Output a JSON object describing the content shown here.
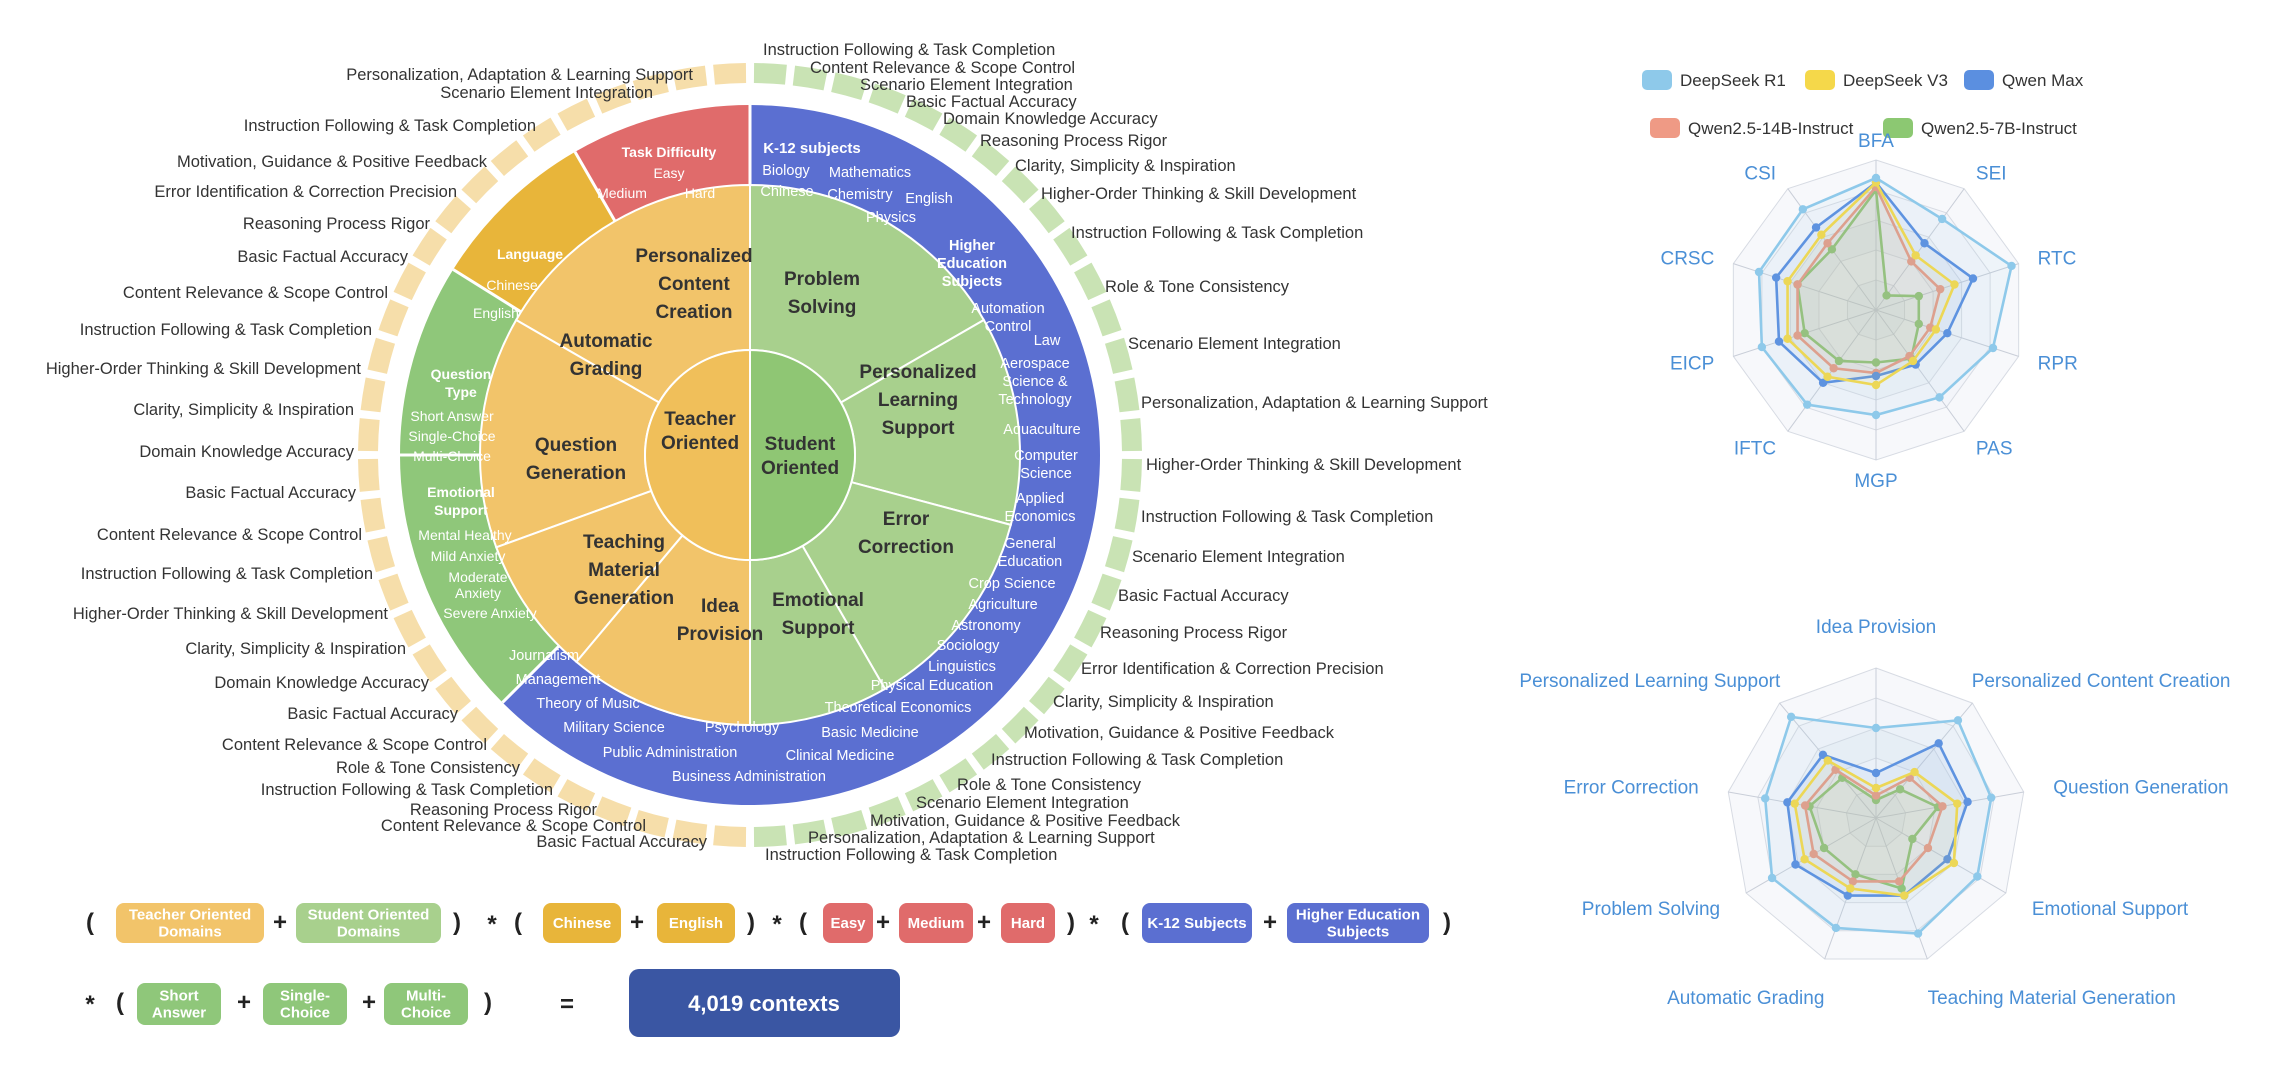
{
  "left_ring_labels": [
    "Personalization, Adaptation & Learning Support",
    "Scenario Element Integration",
    "Instruction Following & Task Completion",
    "Motivation, Guidance & Positive Feedback",
    "Error Identification & Correction Precision",
    "Reasoning Process Rigor",
    "Basic Factual Accuracy",
    "Content Relevance & Scope Control",
    "Instruction Following & Task Completion",
    "Higher-Order Thinking & Skill Development",
    "Clarity, Simplicity & Inspiration",
    "Domain Knowledge Accuracy",
    "Basic Factual Accuracy",
    "Content Relevance & Scope Control",
    "Instruction Following & Task Completion",
    "Higher-Order Thinking & Skill Development",
    "Clarity, Simplicity & Inspiration",
    "Domain Knowledge Accuracy",
    "Basic Factual Accuracy",
    "Content Relevance & Scope Control",
    "Role & Tone Consistency",
    "Instruction Following & Task Completion",
    "Reasoning Process Rigor",
    "Content Relevance & Scope Control",
    "Basic Factual Accuracy"
  ],
  "right_ring_labels": [
    "Instruction Following & Task Completion",
    "Content Relevance & Scope Control",
    "Scenario Element Integration",
    "Basic Factual Accuracy",
    "Domain Knowledge Accuracy",
    "Reasoning Process Rigor",
    "Clarity, Simplicity & Inspiration",
    "Higher-Order Thinking & Skill Development",
    "Instruction Following & Task Completion",
    "Role & Tone Consistency",
    "Scenario Element Integration",
    "Personalization, Adaptation & Learning Support",
    "Higher-Order Thinking & Skill Development",
    "Instruction Following & Task Completion",
    "Scenario Element Integration",
    "Basic Factual Accuracy",
    "Reasoning Process Rigor",
    "Error Identification & Correction Precision",
    "Clarity, Simplicity & Inspiration",
    "Motivation, Guidance & Positive Feedback",
    "Instruction Following & Task Completion",
    "Role & Tone Consistency",
    "Scenario Element Integration",
    "Motivation, Guidance & Positive Feedback",
    "Personalization, Adaptation & Learning Support",
    "Instruction Following & Task Completion"
  ],
  "wheel": {
    "center_left": "Teacher Oriented",
    "center_right": "Student Oriented",
    "teacher_segments": [
      "Personalized Content Creation",
      "Automatic Grading",
      "Question Generation",
      "Teaching Material Generation"
    ],
    "student_segments": [
      "Problem Solving",
      "Personalized Learning Support",
      "Error Correction",
      "Emotional Support",
      "Idea Provision"
    ],
    "difficulty": {
      "title": "Task Difficulty",
      "easy": "Easy",
      "medium": "Medium",
      "hard": "Hard"
    },
    "language": {
      "title": "Language",
      "chinese": "Chinese",
      "english": "English"
    },
    "question_type": {
      "title": "Question Type",
      "items": [
        "Short Answer",
        "Single-Choice",
        "Multi-Choice"
      ]
    },
    "emotional": {
      "title": "Emotional Support",
      "items": [
        "Mental Healthy",
        "Mild Anxiety",
        "Moderate Anxiety",
        "Severe Anxiety"
      ]
    },
    "k12": {
      "title": "K-12 subjects",
      "items": [
        "Biology",
        "Mathematics",
        "Chinese",
        "Chemistry",
        "English",
        "Physics"
      ]
    },
    "higher": {
      "title": "Higher Education Subjects",
      "items": [
        "Automation Control",
        "Law",
        "Aerospace Science & Technology",
        "Aquaculture",
        "Computer Science",
        "Applied Economics",
        "General Education",
        "Crop Science",
        "Agriculture",
        "Astronomy",
        "Sociology",
        "Linguistics",
        "Physical Education",
        "Theoretical Economics",
        "Basic Medicine",
        "Clinical Medicine",
        "Business Administration",
        "Psychology",
        "Public Administration",
        "Military Science",
        "Theory of Music",
        "Management",
        "Journalism"
      ]
    }
  },
  "formula": {
    "teacher": "Teacher Oriented Domains",
    "student": "Student Oriented Domains",
    "chinese": "Chinese",
    "english": "English",
    "easy": "Easy",
    "medium": "Medium",
    "hard": "Hard",
    "k12": "K-12 Subjects",
    "higher": "Higher Education Subjects",
    "short": "Short Answer",
    "single": "Single-Choice",
    "multi": "Multi-Choice",
    "result": "4,019 contexts",
    "plus": "+",
    "times": "*",
    "equals": "=",
    "open": "(",
    "close": ")"
  },
  "colors": {
    "teacher": "#f2c46a",
    "student": "#a8d08d",
    "difficulty": "#e06b6b",
    "language": "#e8b53a",
    "question": "#8fc77a",
    "subjects": "#5b6fd1",
    "result": "#3a56a3"
  },
  "chart_data": [
    {
      "type": "radar",
      "axes": [
        "BFA",
        "SEI",
        "RTC",
        "RPR",
        "PAS",
        "MGP",
        "IFTC",
        "EICP",
        "CRSC",
        "CSI"
      ],
      "legend": [
        "DeepSeek R1",
        "DeepSeek V3",
        "Qwen Max",
        "Qwen2.5-14B-Instruct",
        "Qwen2.5-7B-Instruct"
      ],
      "series": [
        {
          "name": "DeepSeek R1",
          "color": "#8ec9ea",
          "values": [
            0.88,
            0.75,
            0.95,
            0.82,
            0.72,
            0.7,
            0.78,
            0.8,
            0.82,
            0.83
          ]
        },
        {
          "name": "DeepSeek V3",
          "color": "#f5d84a",
          "values": [
            0.85,
            0.45,
            0.55,
            0.42,
            0.42,
            0.5,
            0.55,
            0.62,
            0.62,
            0.62
          ]
        },
        {
          "name": "Qwen Max",
          "color": "#5b8fe0",
          "values": [
            0.85,
            0.55,
            0.68,
            0.5,
            0.45,
            0.44,
            0.6,
            0.68,
            0.7,
            0.68
          ]
        },
        {
          "name": "Qwen2.5-14B-Instruct",
          "color": "#ef9a85",
          "values": [
            0.82,
            0.4,
            0.45,
            0.38,
            0.38,
            0.42,
            0.48,
            0.55,
            0.55,
            0.55
          ]
        },
        {
          "name": "Qwen2.5-7B-Instruct",
          "color": "#8cc872",
          "values": [
            0.8,
            0.12,
            0.3,
            0.3,
            0.4,
            0.35,
            0.42,
            0.5,
            0.55,
            0.5
          ]
        }
      ],
      "legend_placement": "top"
    },
    {
      "type": "radar",
      "axes": [
        "Idea Provision",
        "Personalized Content Creation",
        "Question Generation",
        "Emotional Support",
        "Teaching Material Generation",
        "Automatic Grading",
        "Problem Solving",
        "Error Correction",
        "Personalized Learning Support"
      ],
      "series": [
        {
          "name": "DeepSeek R1",
          "color": "#8ec9ea",
          "values": [
            0.6,
            0.85,
            0.78,
            0.78,
            0.82,
            0.78,
            0.8,
            0.75,
            0.88
          ]
        },
        {
          "name": "DeepSeek V3",
          "color": "#f5d84a",
          "values": [
            0.2,
            0.4,
            0.55,
            0.6,
            0.55,
            0.5,
            0.55,
            0.55,
            0.5
          ]
        },
        {
          "name": "Qwen Max",
          "color": "#5b8fe0",
          "values": [
            0.3,
            0.65,
            0.62,
            0.55,
            0.55,
            0.55,
            0.62,
            0.6,
            0.55
          ]
        },
        {
          "name": "Qwen2.5-14B-Instruct",
          "color": "#ef9a85",
          "values": [
            0.15,
            0.35,
            0.45,
            0.4,
            0.45,
            0.45,
            0.48,
            0.48,
            0.42
          ]
        },
        {
          "name": "Qwen2.5-7B-Instruct",
          "color": "#8cc872",
          "values": [
            0.12,
            0.25,
            0.42,
            0.28,
            0.5,
            0.4,
            0.4,
            0.45,
            0.35
          ]
        }
      ]
    }
  ]
}
